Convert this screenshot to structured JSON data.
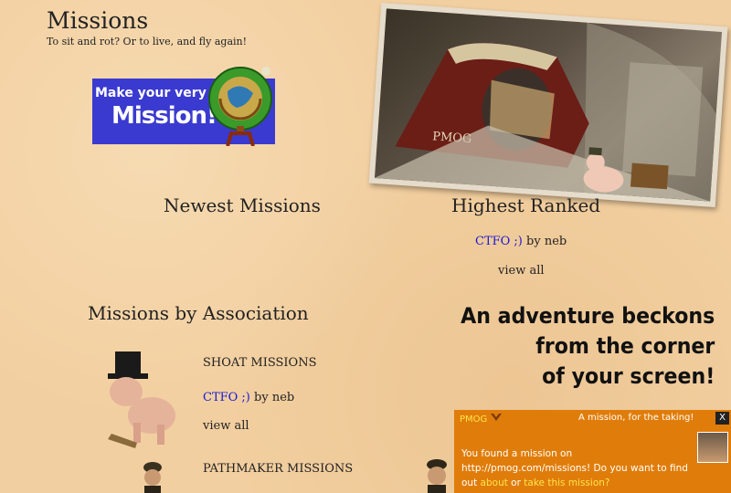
{
  "header": {
    "title": "Missions",
    "subtitle": "To sit and rot? Or to live, and fly again!"
  },
  "banner": {
    "line1": "Make your very own",
    "line2": "Mission!"
  },
  "newest": {
    "heading": "Newest Missions"
  },
  "highest": {
    "heading": "Highest Ranked",
    "item_link": "CTFO ;)",
    "item_by": "by neb",
    "view_all": "view all"
  },
  "association": {
    "heading": "Missions by Association",
    "shoat": {
      "title": "SHOAT MISSIONS",
      "item_link": "CTFO ;)",
      "item_by": "by neb",
      "view_all": "view all"
    },
    "pathmaker": {
      "title": "PATHMAKER MISSIONS"
    }
  },
  "adventure": {
    "line1": "An adventure beckons",
    "line2": "from the corner",
    "line3": "of your screen!"
  },
  "popup": {
    "brand": "PMOG",
    "header": "A mission, for the taking!",
    "close": "X",
    "msg_start": "You found a mission on http://pmog.com/missions! Do you want to find out ",
    "link_about": "about",
    "msg_or": " or ",
    "link_take": "take this mission?"
  },
  "postcard": {
    "sign": "PMOG"
  },
  "colors": {
    "background": "#f2cfa0",
    "link": "#1a1ad6",
    "banner_blue": "#3a3ad0",
    "popup_orange": "#e07d0a",
    "popup_link": "#ffe34d"
  }
}
